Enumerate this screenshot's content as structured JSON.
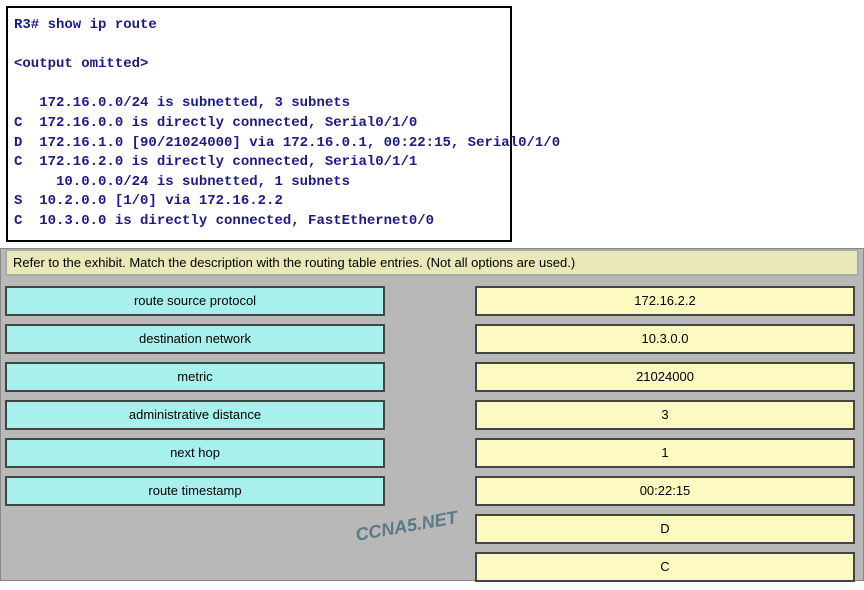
{
  "terminal": {
    "line1": "R3# show ip route",
    "line2": "",
    "line3": "<output omitted>",
    "line4": "",
    "line5": "   172.16.0.0/24 is subnetted, 3 subnets",
    "line6": "C  172.16.0.0 is directly connected, Serial0/1/0",
    "line7": "D  172.16.1.0 [90/21024000] via 172.16.0.1, 00:22:15, Serial0/1/0",
    "line8": "C  172.16.2.0 is directly connected, Serial0/1/1",
    "line9": "     10.0.0.0/24 is subnetted, 1 subnets",
    "line10": "S  10.2.0.0 [1/0] via 172.16.2.2",
    "line11": "C  10.3.0.0 is directly connected, FastEthernet0/0"
  },
  "instructions": "Refer to the exhibit. Match the description with the routing table entries. (Not all options are used.)",
  "left": {
    "item1": "route source protocol",
    "item2": "destination network",
    "item3": "metric",
    "item4": "administrative distance",
    "item5": "next hop",
    "item6": "route timestamp"
  },
  "right": {
    "item1": "172.16.2.2",
    "item2": "10.3.0.0",
    "item3": "21024000",
    "item4": "3",
    "item5": "1",
    "item6": "00:22:15",
    "item7": "D",
    "item8": "C"
  },
  "watermark": "CCNA5.NET"
}
